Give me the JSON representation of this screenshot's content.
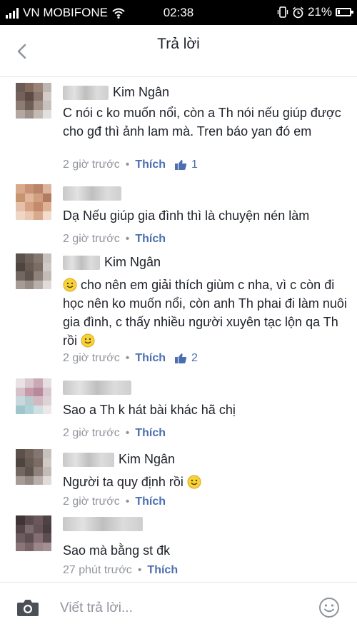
{
  "status_bar": {
    "carrier": "VN MOBIFONE",
    "time": "02:38",
    "battery": "21%",
    "battery_level": 0.21
  },
  "header": {
    "title": "Trả lời"
  },
  "comments": [
    {
      "name": "Kim Ngân",
      "text": "C nói c ko muốn nổi, còn a Th nói nếu giúp được cho gđ thì ảnh lam mà. Tren báo yan đó em",
      "time": "2 giờ trước",
      "like_label": "Thích",
      "likes": "1"
    },
    {
      "name": "",
      "text": "Dạ Nếu giúp gia đình thì là chuyện nén làm",
      "time": "2 giờ trước",
      "like_label": "Thích"
    },
    {
      "name": "Kim Ngân",
      "text_after_emoji": "cho nên em giải thích giùm c nha, vì c còn đi học nên ko muốn nổi, còn anh Th phai đi làm nuôi gia đình, c thấy nhiều người xuyên tạc lộn qa Th rồi",
      "time": "2 giờ trước",
      "like_label": "Thích",
      "likes": "2"
    },
    {
      "name": "",
      "text": "Sao a Th k hát bài khác hã chị",
      "time": "2 giờ trước",
      "like_label": "Thích"
    },
    {
      "name": "Kim Ngân",
      "text": "Người ta quy định rồi",
      "time": "2 giờ trước",
      "like_label": "Thích"
    },
    {
      "name": "",
      "text": "Sao mà bằng st đk",
      "time": "27 phút trước",
      "like_label": "Thích"
    }
  ],
  "footer": {
    "placeholder": "Viết trả lời..."
  },
  "colors": {
    "status_bar_bg": "#000000",
    "link_blue": "#4b6eaf",
    "meta_gray": "#90949c",
    "text": "#1d2129"
  }
}
